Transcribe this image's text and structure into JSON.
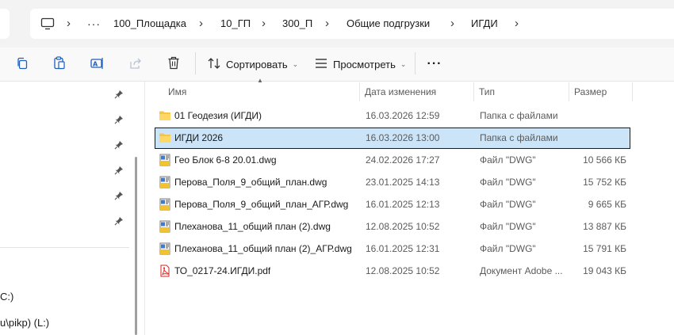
{
  "breadcrumb": {
    "items": [
      "100_Площадка",
      "10_ГП",
      "300_П",
      "Общие подгрузки",
      "ИГДИ"
    ],
    "overflow": "···"
  },
  "toolbar": {
    "sort_label": "Сортировать",
    "view_label": "Просмотреть",
    "more": "···"
  },
  "nav": {
    "partial_items": [
      "C:)",
      "u\\pikp) (L:)"
    ]
  },
  "columns": {
    "name": "Имя",
    "date": "Дата изменения",
    "type": "Тип",
    "size": "Размер"
  },
  "files": [
    {
      "name": "01 Геодезия (ИГДИ)",
      "date": "16.03.2026 12:59",
      "type": "Папка с файлами",
      "size": "",
      "icon": "folder-icon"
    },
    {
      "name": "ИГДИ 2026",
      "date": "16.03.2026 13:00",
      "type": "Папка с файлами",
      "size": "",
      "icon": "folder-icon",
      "selected": true
    },
    {
      "name": "Гео Блок 6-8 20.01.dwg",
      "date": "24.02.2026 17:27",
      "type": "Файл \"DWG\"",
      "size": "10 566 КБ",
      "icon": "dwg-file-icon"
    },
    {
      "name": "Перова_Поля_9_общий_план.dwg",
      "date": "23.01.2025 14:13",
      "type": "Файл \"DWG\"",
      "size": "15 752 КБ",
      "icon": "dwg-file-icon"
    },
    {
      "name": "Перова_Поля_9_общий_план_АГР.dwg",
      "date": "16.01.2025 12:13",
      "type": "Файл \"DWG\"",
      "size": "9 665 КБ",
      "icon": "dwg-file-icon"
    },
    {
      "name": "Плеханова_11_общий план (2).dwg",
      "date": "12.08.2025 10:52",
      "type": "Файл \"DWG\"",
      "size": "13 887 КБ",
      "icon": "dwg-file-icon"
    },
    {
      "name": "Плеханова_11_общий план (2)_АГР.dwg",
      "date": "16.01.2025 12:31",
      "type": "Файл \"DWG\"",
      "size": "15 791 КБ",
      "icon": "dwg-file-icon"
    },
    {
      "name": "ТО_0217-24.ИГДИ.pdf",
      "date": "12.08.2025 10:52",
      "type": "Документ Adobe ...",
      "size": "19 043 КБ",
      "icon": "pdf-file-icon"
    }
  ],
  "colors": {
    "selection": "#cce4f7",
    "folder": "#f7c542",
    "pdf": "#d9261c"
  }
}
